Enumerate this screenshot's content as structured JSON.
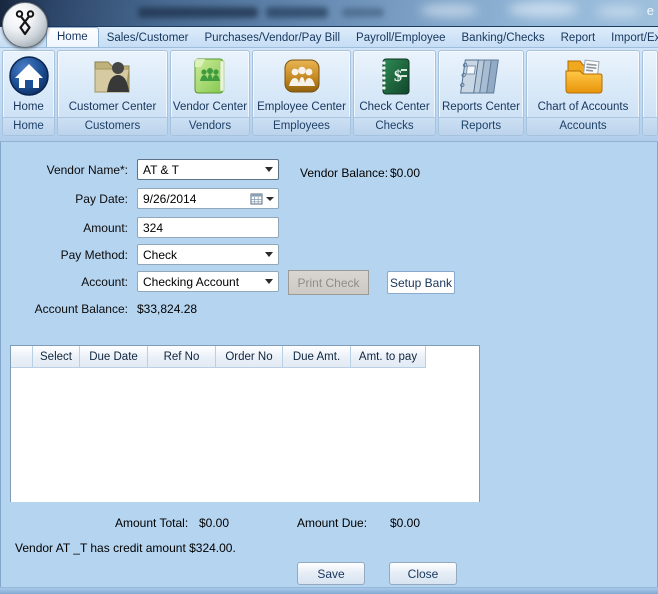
{
  "window": {
    "titlebar_right_text": "e"
  },
  "tabs": [
    {
      "label": "Home",
      "active": true
    },
    {
      "label": "Sales/Customer",
      "active": false
    },
    {
      "label": "Purchases/Vendor/Pay Bill",
      "active": false
    },
    {
      "label": "Payroll/Employee",
      "active": false
    },
    {
      "label": "Banking/Checks",
      "active": false
    },
    {
      "label": "Report",
      "active": false
    },
    {
      "label": "Import/Export",
      "active": false
    }
  ],
  "ribbon": {
    "groups": [
      {
        "button": "Home",
        "caption": "Home",
        "icon": "home-icon"
      },
      {
        "button": "Customer Center",
        "caption": "Customers",
        "icon": "customer-folder-icon"
      },
      {
        "button": "Vendor Center",
        "caption": "Vendors",
        "icon": "vendor-book-icon"
      },
      {
        "button": "Employee Center",
        "caption": "Employees",
        "icon": "employees-icon"
      },
      {
        "button": "Check Center",
        "caption": "Checks",
        "icon": "checkbook-icon"
      },
      {
        "button": "Reports Center",
        "caption": "Reports",
        "icon": "report-binders-icon"
      },
      {
        "button": "Chart of Accounts",
        "caption": "Accounts",
        "icon": "accounts-folder-icon"
      }
    ]
  },
  "form": {
    "vendor_name": {
      "label": "Vendor Name*:",
      "value": "AT & T"
    },
    "vendor_balance": {
      "label": "Vendor Balance:",
      "value": "$0.00"
    },
    "pay_date": {
      "label": "Pay Date:",
      "value": "9/26/2014"
    },
    "amount": {
      "label": "Amount:",
      "value": "324"
    },
    "pay_method": {
      "label": "Pay Method:",
      "value": "Check"
    },
    "account": {
      "label": "Account:",
      "value": "Checking Account"
    },
    "print_check_label": "Print Check",
    "setup_bank_label": "Setup Bank",
    "account_balance": {
      "label": "Account Balance:",
      "value": "$33,824.28"
    }
  },
  "table": {
    "columns": [
      "Select",
      "Due Date",
      "Ref No",
      "Order No",
      "Due Amt.",
      "Amt. to pay"
    ],
    "rows": []
  },
  "totals": {
    "amount_total_label": "Amount Total:",
    "amount_total": "$0.00",
    "amount_due_label": "Amount Due:",
    "amount_due": "$0.00"
  },
  "credit_note": "Vendor AT _T has credit amount $324.00.",
  "buttons": {
    "save": "Save",
    "close": "Close"
  },
  "colors": {
    "content_background": "#b5d4f0",
    "titlebar_dark": "#2c4568",
    "accent_text": "#17365c",
    "disabled_button": "#d4d1cc",
    "grid_border": "#7f9db9"
  }
}
